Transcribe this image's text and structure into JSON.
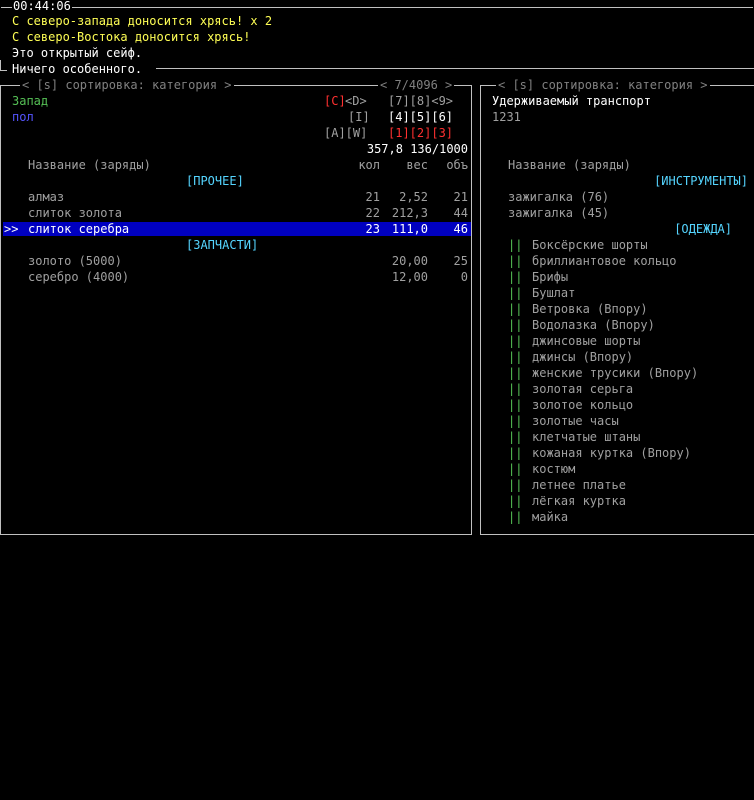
{
  "log": {
    "time": "00:44:06",
    "messages": [
      {
        "text": "С северо-запада доносится хрясь! x 2",
        "color": "yellow"
      },
      {
        "text": "С северо-Востока доносится хрясь!",
        "color": "yellow"
      },
      {
        "text": "Это открытый сейф.",
        "color": "white"
      },
      {
        "text": "Ничего особенного.",
        "color": "white"
      }
    ]
  },
  "left_panel": {
    "title": "< [s] сортировка: категория >",
    "page": "< 7/4096 >",
    "direction": "Запад",
    "surface": "пол",
    "dir_keys": {
      "row1": {
        "a": "[C]",
        "b": "<D>",
        "c": "[7][8]<9>"
      },
      "row2": {
        "a": "[I]",
        "b": "[4][5][6]"
      },
      "row3": {
        "a": "[A][W]",
        "b": "[1][2][3]"
      }
    },
    "totals": "357,8 136/1000",
    "headers": {
      "name": "Название (заряды)",
      "qty": "кол",
      "weight": "вес",
      "volume": "объ"
    },
    "categories": [
      {
        "name": "[ПРОЧЕЕ]",
        "items": [
          {
            "name": "алмаз",
            "qty": "21",
            "weight": "2,52",
            "volume": "21",
            "selected": false
          },
          {
            "name": "слиток золота",
            "qty": "22",
            "weight": "212,3",
            "volume": "44",
            "selected": false
          },
          {
            "name": "слиток серебра",
            "qty": "23",
            "weight": "111,0",
            "volume": "46",
            "selected": true
          }
        ]
      },
      {
        "name": "[ЗАПЧАСТИ]",
        "items": [
          {
            "name": "золото (5000)",
            "qty": "",
            "weight": "20,00",
            "volume": "25",
            "selected": false
          },
          {
            "name": "серебро (4000)",
            "qty": "",
            "weight": "12,00",
            "volume": "0",
            "selected": false
          }
        ]
      }
    ],
    "cursor": ">>"
  },
  "right_panel": {
    "title": "< [s] сортировка: категория >",
    "vehicle": "Удерживаемый транспорт",
    "value": "1231",
    "header_name": "Название (заряды)",
    "tools_category": "[ИНСТРУМЕНТЫ]",
    "tools": [
      "зажигалка (76)",
      "зажигалка (45)"
    ],
    "clothes_category": "[ОДЕЖДА]",
    "clothes_marker": "||",
    "clothes": [
      "Боксёрские шорты",
      "бриллиантовое кольцо",
      "Брифы",
      "Бушлат",
      "Ветровка (Впору)",
      "Водолазка (Впору)",
      "джинсовые шорты",
      "джинсы (Впору)",
      "женские трусики (Впору)",
      "золотая серьга",
      "золотое кольцо",
      "золотые часы",
      "клетчатые штаны",
      "кожаная куртка (Впору)",
      "костюм",
      "летнее платье",
      "лёгкая куртка",
      "майка"
    ]
  },
  "colors": {
    "selection": "#0000c0",
    "category": "#55d5ff",
    "direction": "#55c055",
    "surface": "#5555ff",
    "active_key": "#ff3030"
  }
}
